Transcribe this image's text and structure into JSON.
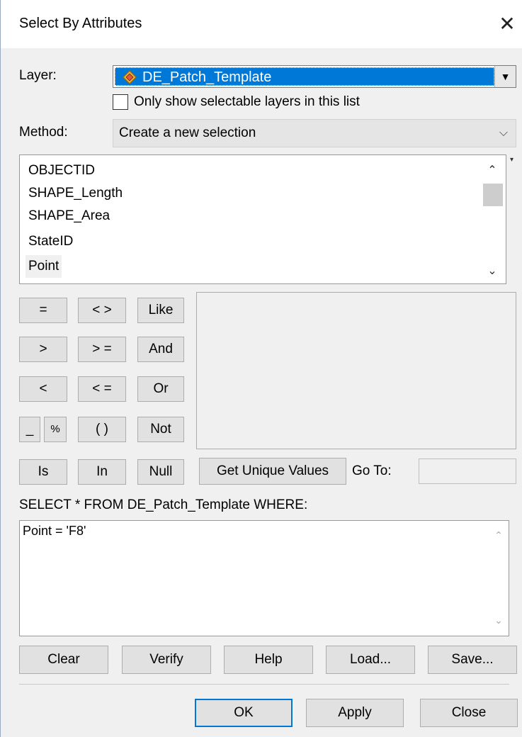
{
  "window": {
    "title": "Select By Attributes",
    "close_symbol": "✕"
  },
  "layer": {
    "label": "Layer:",
    "value": "DE_Patch_Template",
    "icon": "feature-layer-icon",
    "checkbox_label": "Only show selectable layers in this list",
    "checkbox_checked": false
  },
  "method": {
    "label": "Method:",
    "value": "Create a new selection"
  },
  "fields": [
    "OBJECTID",
    "SHAPE_Length",
    "SHAPE_Area",
    "StateID",
    "Point"
  ],
  "selected_field": "Point",
  "operators": {
    "eq": "=",
    "neq": "< >",
    "like": "Like",
    "gt": ">",
    "gte": "> =",
    "and": "And",
    "lt": "<",
    "lte": "< =",
    "or": "Or",
    "underscore": "_",
    "percent": "%",
    "parens": "( )",
    "not": "Not",
    "is": "Is",
    "in": "In",
    "null": "Null"
  },
  "unique": {
    "button": "Get Unique Values",
    "goto_label": "Go To:",
    "goto_value": ""
  },
  "sql": {
    "prefix": "SELECT * FROM DE_Patch_Template WHERE:",
    "expression": "Point = 'F8'"
  },
  "actions": {
    "clear": "Clear",
    "verify": "Verify",
    "help": "Help",
    "load": "Load...",
    "save": "Save..."
  },
  "footer": {
    "ok": "OK",
    "apply": "Apply",
    "close": "Close"
  }
}
